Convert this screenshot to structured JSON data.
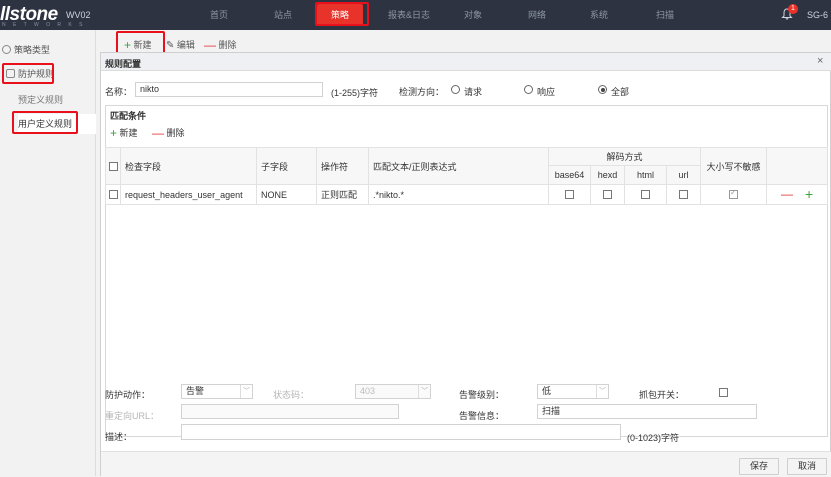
{
  "topbar": {
    "logo": "llstone",
    "logo_sub": "N E T W O R K S",
    "model": "WV02",
    "nav": [
      "首页",
      "站点",
      "策略",
      "报表&日志",
      "对象",
      "网络",
      "系统",
      "扫描"
    ],
    "active_nav": "策略",
    "alert_count": "1",
    "user": "SG-6"
  },
  "sidebar": {
    "items": [
      "策略类型",
      "防护规则",
      "预定义规则",
      "用户定义规则"
    ]
  },
  "toolbar": {
    "new": "新建",
    "edit": "编辑",
    "delete": "删除"
  },
  "dialog": {
    "title": "规则配置",
    "close": "×",
    "name_label": "名称：",
    "name_value": "nikto",
    "name_hint": "(1-255)字符",
    "direction_label": "检测方向：",
    "direction_options": [
      "请求",
      "响应",
      "全部"
    ],
    "direction_selected": "全部",
    "match_section": {
      "title": "匹配条件",
      "new": "新建",
      "delete": "删除",
      "columns": {
        "field": "检查字段",
        "subfield": "子字段",
        "operator": "操作符",
        "pattern": "匹配文本/正则表达式",
        "decode": "解码方式",
        "decode_sub": [
          "base64",
          "hexd",
          "html",
          "url"
        ],
        "case": "大小写不敏感"
      },
      "rows": [
        {
          "field": "request_headers_user_agent",
          "subfield": "NONE",
          "operator": "正则匹配",
          "pattern": ".*nikto.*",
          "base64": false,
          "hexd": false,
          "html": false,
          "url": false,
          "case_insensitive": true
        }
      ]
    },
    "action_label": "防护动作：",
    "action_value": "告警",
    "status_label": "状态码：",
    "status_value": "403",
    "redirect_label": "重定向URL：",
    "level_label": "告警级别：",
    "level_value": "低",
    "capture_label": "抓包开关：",
    "info_label": "告警信息：",
    "info_value": "扫描",
    "desc_label": "描述：",
    "desc_hint": "(0-1023)字符",
    "save": "保存",
    "cancel": "取消"
  },
  "colors": {
    "topbar_bg": "#2d3340",
    "active_nav": "#e8332a",
    "highlight_box": "#e8101a",
    "add_green": "#3aa33a",
    "delete_red": "#e23030"
  }
}
